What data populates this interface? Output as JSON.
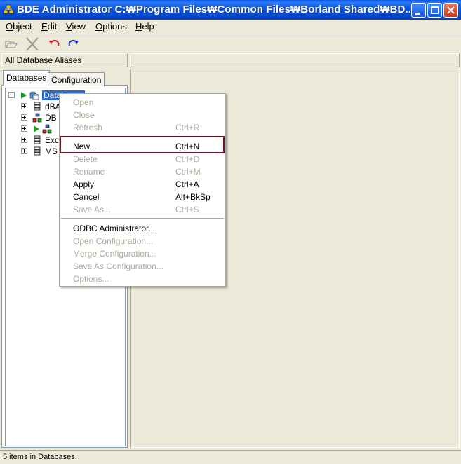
{
  "window": {
    "title": "BDE Administrator  C:₩Program Files₩Common Files₩Borland Shared₩BD..."
  },
  "menubar": {
    "items": [
      {
        "label": "Object",
        "u": "O",
        "rest": "bject"
      },
      {
        "label": "Edit",
        "u": "E",
        "rest": "dit"
      },
      {
        "label": "View",
        "u": "V",
        "rest": "iew"
      },
      {
        "label": "Options",
        "u": "O",
        "rest": "ptions"
      },
      {
        "label": "Help",
        "u": "H",
        "rest": "elp"
      }
    ]
  },
  "header": {
    "left_title": "All Database Aliases"
  },
  "tabs": [
    {
      "label": "Databases"
    },
    {
      "label": "Configuration"
    }
  ],
  "tree": {
    "root": "Databases",
    "items": [
      "dBA",
      "DB",
      "",
      "Exc",
      "MS"
    ]
  },
  "context_menu": {
    "items": [
      {
        "label": "Open",
        "shortcut": "",
        "disabled": true
      },
      {
        "label": "Close",
        "shortcut": "",
        "disabled": true
      },
      {
        "label": "Refresh",
        "shortcut": "Ctrl+R",
        "disabled": true
      },
      {
        "label": "New...",
        "shortcut": "Ctrl+N",
        "disabled": false
      },
      {
        "label": "Delete",
        "shortcut": "Ctrl+D",
        "disabled": true
      },
      {
        "label": "Rename",
        "shortcut": "Ctrl+M",
        "disabled": true
      },
      {
        "label": "Apply",
        "shortcut": "Ctrl+A",
        "disabled": false
      },
      {
        "label": "Cancel",
        "shortcut": "Alt+BkSp",
        "disabled": false
      },
      {
        "label": "Save As...",
        "shortcut": "Ctrl+S",
        "disabled": true
      },
      {
        "label": "ODBC Administrator...",
        "shortcut": "",
        "disabled": false
      },
      {
        "label": "Open Configuration...",
        "shortcut": "",
        "disabled": true
      },
      {
        "label": "Merge Configuration...",
        "shortcut": "",
        "disabled": true
      },
      {
        "label": "Save As Configuration...",
        "shortcut": "",
        "disabled": true
      },
      {
        "label": "Options...",
        "shortcut": "",
        "disabled": true
      }
    ]
  },
  "statusbar": {
    "text": "5 items in Databases."
  },
  "colors": {
    "titlebar": "#0A55E0",
    "selection": "#316AC5",
    "highlight_box": "#6B1A2A",
    "disabled_text": "#ACA899"
  }
}
